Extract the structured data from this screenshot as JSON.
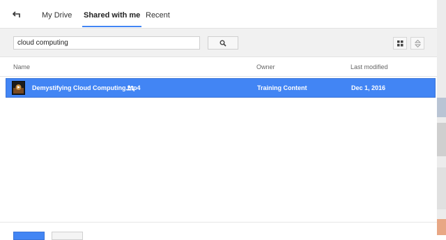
{
  "tabs": [
    {
      "label": "My Drive"
    },
    {
      "label": "Shared with me",
      "active": true
    },
    {
      "label": "Recent"
    }
  ],
  "search": {
    "value": "cloud computing"
  },
  "icons": {
    "back": "back-arrow-icon",
    "search": "search-icon",
    "grid": "grid-view-icon",
    "sort": "sort-icon",
    "shared": "shared-people-icon",
    "video": "video-thumbnail-icon"
  },
  "columns": {
    "name": "Name",
    "owner": "Owner",
    "modified": "Last modified"
  },
  "files": [
    {
      "name": "Demystifying Cloud Computing.mp4",
      "owner": "Training Content",
      "modified": "Dec 1, 2016",
      "selected": true
    }
  ],
  "colors": {
    "accent": "#4285f4",
    "toolbar": "#f1f1f1",
    "selected_row": "#4285f4"
  }
}
